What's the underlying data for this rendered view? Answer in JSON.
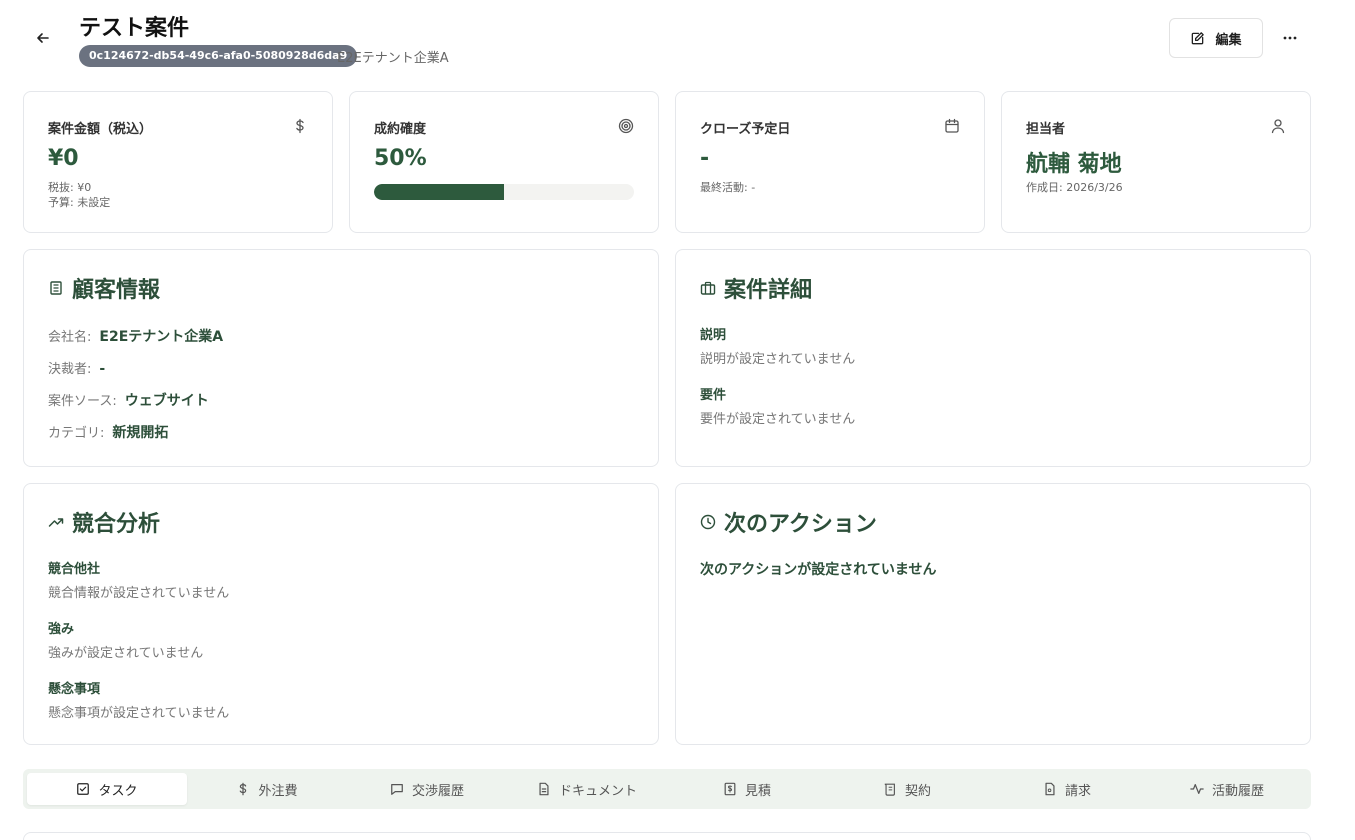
{
  "header": {
    "title": "テスト案件",
    "deal_id": "0c124672-db54-49c6-afa0-5080928d6da9",
    "tenant": "E2Eテナント企業A",
    "edit_label": "編集",
    "more_label": "···"
  },
  "stats": [
    {
      "title": "案件金額（税込）",
      "icon": "dollar-icon",
      "value": "¥0",
      "sub1": "税抜: ¥0",
      "sub2": "予算: 未設定"
    },
    {
      "title": "成約確度",
      "icon": "target-icon",
      "value": "50%",
      "progress": 0.5
    },
    {
      "title": "クローズ予定日",
      "icon": "calendar-icon",
      "value": "-",
      "sub1": "最終活動: -"
    },
    {
      "title": "担当者",
      "icon": "user-icon",
      "value": "航輔 菊地",
      "sub1": "作成日: 2026/3/26"
    }
  ],
  "customer": {
    "title": "顧客情報",
    "rows": [
      {
        "label": "会社名:",
        "value": "E2Eテナント企業A"
      },
      {
        "label": "決裁者:",
        "value": "-"
      },
      {
        "label": "案件ソース:",
        "value": "ウェブサイト"
      },
      {
        "label": "カテゴリ:",
        "value": "新規開拓"
      }
    ]
  },
  "details": {
    "title": "案件詳細",
    "fields": [
      {
        "label": "説明",
        "value": "説明が設定されていません"
      },
      {
        "label": "要件",
        "value": "要件が設定されていません"
      }
    ]
  },
  "competition": {
    "title": "競合分析",
    "fields": [
      {
        "label": "競合他社",
        "value": "競合情報が設定されていません"
      },
      {
        "label": "強み",
        "value": "強みが設定されていません"
      },
      {
        "label": "懸念事項",
        "value": "懸念事項が設定されていません"
      }
    ]
  },
  "next_action": {
    "title": "次のアクション",
    "text": "次のアクションが設定されていません"
  },
  "tabs": [
    {
      "label": "タスク",
      "icon": "checkbox-icon",
      "active": true
    },
    {
      "label": "外注費",
      "icon": "dollar-icon"
    },
    {
      "label": "交渉履歴",
      "icon": "chat-icon"
    },
    {
      "label": "ドキュメント",
      "icon": "document-icon"
    },
    {
      "label": "見積",
      "icon": "estimate-icon"
    },
    {
      "label": "契約",
      "icon": "contract-icon"
    },
    {
      "label": "請求",
      "icon": "invoice-icon"
    },
    {
      "label": "活動履歴",
      "icon": "activity-icon"
    }
  ],
  "colors": {
    "accent": "#2d5a3d",
    "muted": "#777777",
    "tabbar": "#eef3ee"
  }
}
